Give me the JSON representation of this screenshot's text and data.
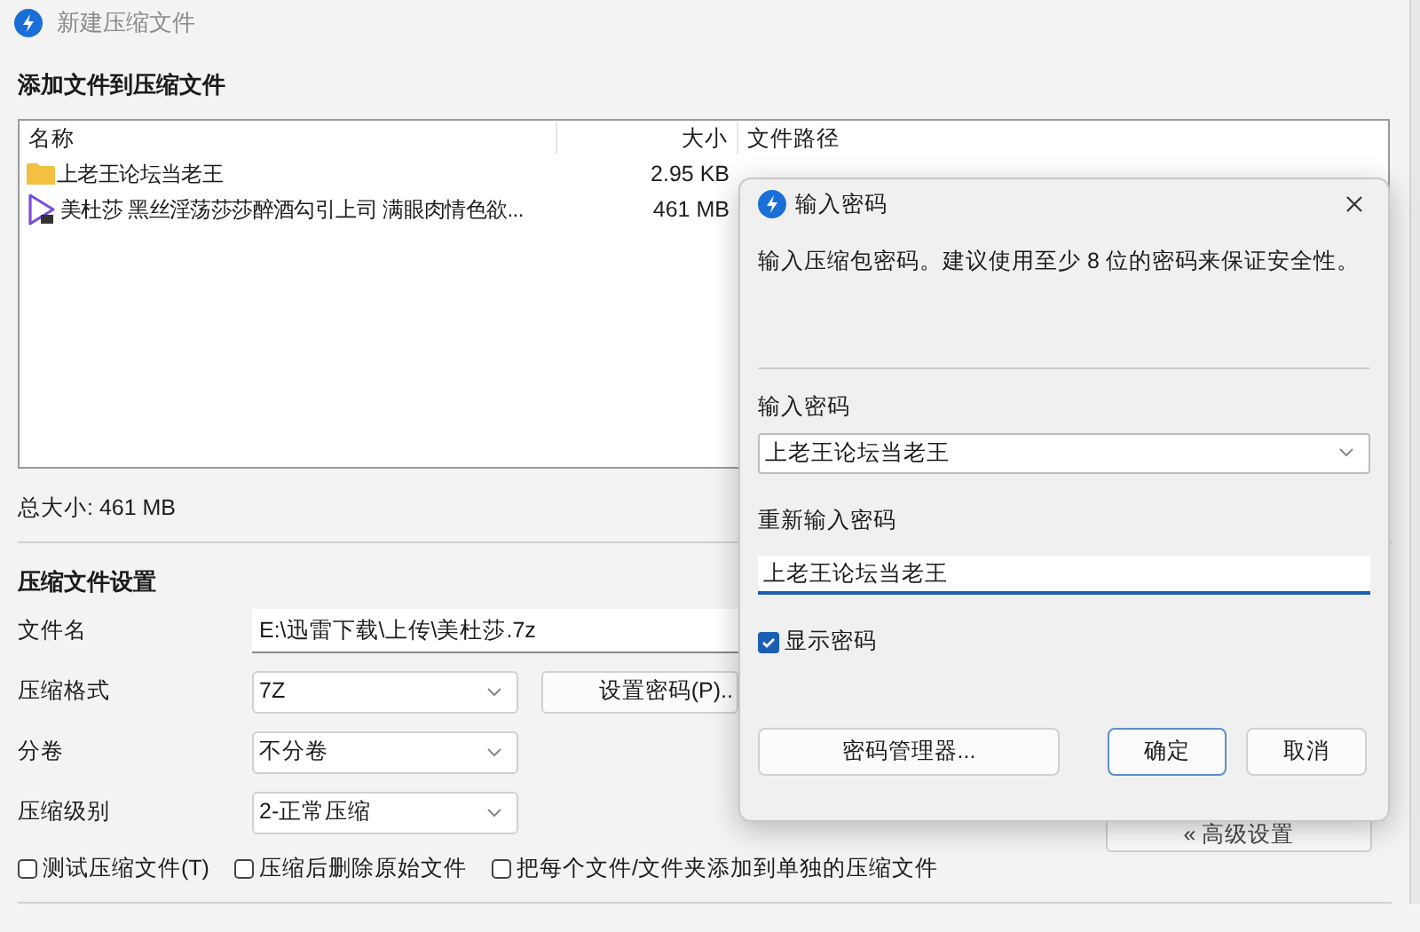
{
  "window": {
    "title": "新建压缩文件"
  },
  "files_section": {
    "heading": "添加文件到压缩文件",
    "columns": [
      "名称",
      "大小",
      "文件路径"
    ],
    "rows": [
      {
        "kind": "folder",
        "name": "上老王论坛当老王",
        "size": "2.95 KB"
      },
      {
        "kind": "video",
        "name": "美杜莎  黑丝淫荡莎莎醉酒勾引上司 满眼肉情色欲...",
        "size": "461 MB"
      }
    ],
    "total": "总大小: 461 MB"
  },
  "settings": {
    "heading": "压缩文件设置",
    "fields": [
      {
        "kind": "text",
        "label": "文件名",
        "value": "E:\\迅雷下载\\上传\\美杜莎.7z"
      },
      {
        "kind": "select",
        "label": "压缩格式",
        "value": "7Z"
      },
      {
        "kind": "select",
        "label": "分卷",
        "value": "不分卷"
      },
      {
        "kind": "select",
        "label": "压缩级别",
        "value": "2-正常压缩"
      }
    ],
    "password_button": "设置密码(P)..",
    "options": [
      {
        "label": "测试压缩文件(T)",
        "checked": false
      },
      {
        "label": "压缩后删除原始文件",
        "checked": false
      },
      {
        "label": "把每个文件/文件夹添加到单独的压缩文件",
        "checked": false
      }
    ],
    "advanced_button": "« 高级设置"
  },
  "dialog": {
    "title": "输入密码",
    "description": "输入压缩包密码。建议使用至少 8 位的密码来保证安全性。",
    "password_label": "输入密码",
    "password": "上老王论坛当老王",
    "confirm_label": "重新输入密码",
    "confirm": "上老王论坛当老王",
    "show_password": {
      "label": "显示密码",
      "checked": true
    },
    "buttons": [
      {
        "kind": "secondary",
        "label": "密码管理器..."
      },
      {
        "kind": "primary",
        "label": "确定"
      },
      {
        "kind": "secondary",
        "label": "取消"
      }
    ]
  }
}
